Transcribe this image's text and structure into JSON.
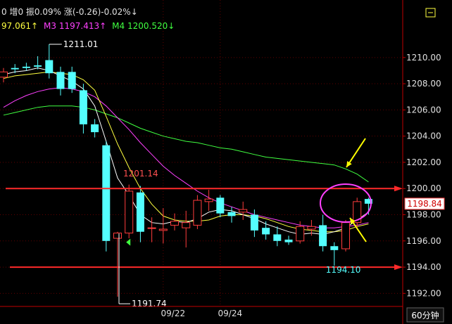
{
  "header": {
    "line1": [
      {
        "text": "0 增0 振0.09% 涨(-0.26)-0.02%↓",
        "color": "#e0e0e0"
      }
    ],
    "line2": [
      {
        "text": "97.061↑",
        "color": "#ffff40"
      },
      {
        "text": "M3 1197.413↑",
        "color": "#ff40ff"
      },
      {
        "text": "M4 1200.520↓",
        "color": "#40ff40"
      }
    ]
  },
  "period_button": "60分钟",
  "price_tag": "1198.84",
  "colors": {
    "up": "#ff3c3c",
    "down": "#54ffff",
    "ma1": "#ffffff",
    "ma2": "#ffff40",
    "ma3": "#ff40ff",
    "ma4": "#40ff40",
    "axis": "#c00000",
    "grid": "#600000",
    "annotation_line": "#ff2a2a",
    "circle": "#ff40ff",
    "arrow": "#ffff00"
  },
  "chart_data": {
    "type": "candlestick",
    "y_axis": {
      "min": 1191.0,
      "max": 1211.6,
      "ticks": [
        1192.0,
        1194.0,
        1196.0,
        1198.0,
        1200.0,
        1202.0,
        1204.0,
        1206.0,
        1208.0,
        1210.0
      ]
    },
    "x_labels": [
      {
        "text": "09/22",
        "index": 14
      },
      {
        "text": "09/24",
        "index": 19
      }
    ],
    "candles": [
      {
        "o": 1208.5,
        "h": 1209.2,
        "l": 1208.1,
        "c": 1208.9
      },
      {
        "o": 1209.2,
        "h": 1209.5,
        "l": 1208.8,
        "c": 1209.1
      },
      {
        "o": 1209.3,
        "h": 1209.6,
        "l": 1209.0,
        "c": 1209.2
      },
      {
        "o": 1209.4,
        "h": 1210.1,
        "l": 1209.1,
        "c": 1209.3
      },
      {
        "o": 1209.8,
        "h": 1211.01,
        "l": 1208.4,
        "c": 1208.8
      },
      {
        "o": 1208.9,
        "h": 1209.3,
        "l": 1207.1,
        "c": 1207.6
      },
      {
        "o": 1208.9,
        "h": 1209.3,
        "l": 1207.3,
        "c": 1207.6
      },
      {
        "o": 1207.5,
        "h": 1208.0,
        "l": 1204.2,
        "c": 1204.9
      },
      {
        "o": 1204.9,
        "h": 1205.3,
        "l": 1203.9,
        "c": 1204.3
      },
      {
        "o": 1203.3,
        "h": 1203.6,
        "l": 1195.2,
        "c": 1196.0
      },
      {
        "o": 1196.2,
        "h": 1196.7,
        "l": 1191.74,
        "c": 1196.6
      },
      {
        "o": 1196.6,
        "h": 1200.3,
        "l": 1196.2,
        "c": 1199.8
      },
      {
        "o": 1199.7,
        "h": 1200.2,
        "l": 1195.9,
        "c": 1196.7
      },
      {
        "o": 1197.0,
        "h": 1197.8,
        "l": 1195.9,
        "c": 1197.0
      },
      {
        "o": 1196.8,
        "h": 1198.5,
        "l": 1195.8,
        "c": 1196.9
      },
      {
        "o": 1197.2,
        "h": 1198.1,
        "l": 1196.8,
        "c": 1197.5
      },
      {
        "o": 1197.0,
        "h": 1198.3,
        "l": 1195.5,
        "c": 1197.4
      },
      {
        "o": 1197.2,
        "h": 1199.5,
        "l": 1196.9,
        "c": 1199.1
      },
      {
        "o": 1199.0,
        "h": 1199.9,
        "l": 1198.3,
        "c": 1199.2
      },
      {
        "o": 1199.3,
        "h": 1199.5,
        "l": 1197.8,
        "c": 1198.1
      },
      {
        "o": 1198.2,
        "h": 1198.6,
        "l": 1197.4,
        "c": 1197.9
      },
      {
        "o": 1198.2,
        "h": 1199.0,
        "l": 1197.6,
        "c": 1198.4
      },
      {
        "o": 1198.0,
        "h": 1198.4,
        "l": 1196.3,
        "c": 1196.8
      },
      {
        "o": 1197.0,
        "h": 1197.5,
        "l": 1196.1,
        "c": 1196.5
      },
      {
        "o": 1196.5,
        "h": 1197.1,
        "l": 1195.6,
        "c": 1196.0
      },
      {
        "o": 1196.1,
        "h": 1196.4,
        "l": 1195.7,
        "c": 1195.9
      },
      {
        "o": 1196.0,
        "h": 1197.5,
        "l": 1195.8,
        "c": 1197.1
      },
      {
        "o": 1196.9,
        "h": 1197.6,
        "l": 1196.4,
        "c": 1197.1
      },
      {
        "o": 1197.2,
        "h": 1198.0,
        "l": 1195.2,
        "c": 1195.6
      },
      {
        "o": 1195.6,
        "h": 1195.9,
        "l": 1194.1,
        "c": 1195.3
      },
      {
        "o": 1195.4,
        "h": 1197.6,
        "l": 1195.2,
        "c": 1197.4
      },
      {
        "o": 1197.4,
        "h": 1199.3,
        "l": 1197.0,
        "c": 1199.0
      },
      {
        "o": 1199.2,
        "h": 1199.3,
        "l": 1198.0,
        "c": 1198.84
      }
    ],
    "moving_averages": {
      "ma1": [
        1208.7,
        1208.9,
        1209.0,
        1209.2,
        1209.0,
        1208.6,
        1208.2,
        1207.6,
        1206.3,
        1203.6,
        1200.8,
        1199.5,
        1198.0,
        1197.4,
        1197.3,
        1197.5,
        1197.4,
        1197.7,
        1198.2,
        1198.4,
        1198.3,
        1198.0,
        1197.7,
        1197.3,
        1197.0,
        1196.7,
        1196.5,
        1196.6,
        1196.5,
        1196.7,
        1197.0,
        1197.6,
        1198.2
      ],
      "ma2": [
        1208.4,
        1208.6,
        1208.7,
        1208.8,
        1208.9,
        1208.8,
        1208.7,
        1208.3,
        1207.5,
        1205.5,
        1203.4,
        1201.6,
        1200.0,
        1198.8,
        1197.9,
        1197.6,
        1197.5,
        1197.5,
        1197.6,
        1197.9,
        1198.0,
        1198.0,
        1197.9,
        1197.7,
        1197.4,
        1197.1,
        1196.9,
        1196.8,
        1196.7,
        1196.7,
        1196.8,
        1197.1,
        1197.3
      ],
      "ma3": [
        1206.2,
        1206.7,
        1207.1,
        1207.4,
        1207.6,
        1207.7,
        1207.6,
        1207.4,
        1207.0,
        1206.3,
        1205.4,
        1204.5,
        1203.5,
        1202.6,
        1201.7,
        1201.0,
        1200.4,
        1199.8,
        1199.3,
        1198.9,
        1198.6,
        1198.3,
        1198.0,
        1197.8,
        1197.6,
        1197.4,
        1197.2,
        1197.1,
        1197.0,
        1197.0,
        1197.1,
        1197.2,
        1197.4
      ],
      "ma4": [
        1205.6,
        1205.8,
        1206.0,
        1206.2,
        1206.3,
        1206.3,
        1206.3,
        1206.2,
        1206.0,
        1205.7,
        1205.4,
        1205.0,
        1204.6,
        1204.3,
        1204.0,
        1203.8,
        1203.6,
        1203.5,
        1203.3,
        1203.1,
        1203.0,
        1202.8,
        1202.6,
        1202.4,
        1202.3,
        1202.2,
        1202.1,
        1202.0,
        1201.9,
        1201.8,
        1201.5,
        1201.1,
        1200.5
      ]
    },
    "annotations": {
      "high_label": {
        "text": "1211.01",
        "index": 4
      },
      "low_label": {
        "text": "1191.74",
        "index": 10
      },
      "mid_label": {
        "text": "1201.14",
        "index": 10
      },
      "low2_label": {
        "text": "1194.10",
        "index": 29
      },
      "line_upper": 1200.0,
      "line_lower": 1194.0
    }
  }
}
